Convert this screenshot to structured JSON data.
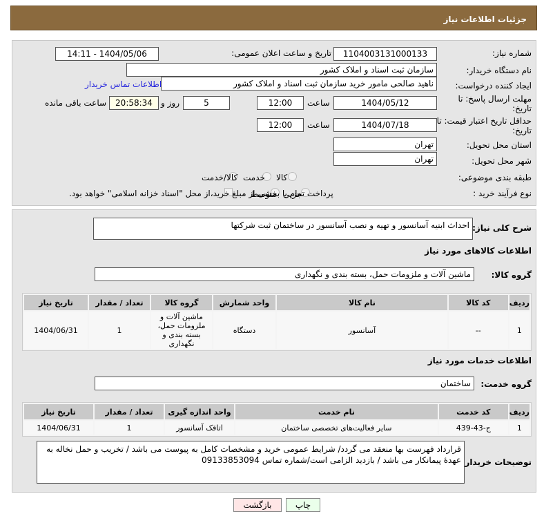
{
  "header": {
    "title": "جزئیات اطلاعات نیاز"
  },
  "form": {
    "need_number_label": "شماره نیاز:",
    "need_number": "1104003131000133",
    "announce_label": "تاریخ و ساعت اعلان عمومی:",
    "announce_value": "1404/05/06 - 14:11",
    "buyer_org_label": "نام دستگاه خریدار:",
    "buyer_org": "سازمان ثبت اسناد و املاک کشور",
    "creator_label": "ایجاد کننده درخواست:",
    "creator": "ناهید صالحی مامور خرید سازمان ثبت اسناد و املاک کشور",
    "contact_link": "اطلاعات تماس خریدار",
    "deadline_label": "مهلت ارسال پاسخ: تا تاریخ:",
    "deadline_date": "1404/05/12",
    "time_label": "ساعت",
    "deadline_time": "12:00",
    "days": "5",
    "days_label": "روز و",
    "remaining": "20:58:34",
    "remaining_label": "ساعت باقی مانده",
    "validity_label": "حداقل تاریخ اعتبار قیمت: تا تاریخ:",
    "validity_date": "1404/07/18",
    "validity_time": "12:00",
    "province_label": "استان محل تحویل:",
    "province": "تهران",
    "city_label": "شهر محل تحویل:",
    "city": "تهران",
    "category_label": "طبقه بندی موضوعی:",
    "category_options": [
      "کالا",
      "خدمت",
      "کالا/خدمت"
    ],
    "process_label": "نوع فرآیند خرید :",
    "process_options": [
      "جزیی",
      "متوسط"
    ],
    "payment_note": "پرداخت تمام یا بخشی از مبلغ خرید،از محل \"اسناد خزانه اسلامی\" خواهد بود."
  },
  "description": {
    "label": "شرح کلی نیاز:",
    "value": "احداث ابنیه آسانسور و تهیه و نصب آسانسور در ساختمان ثبت شرکتها"
  },
  "goods": {
    "title": "اطلاعات کالاهای مورد نیاز",
    "group_label": "گروه کالا:",
    "group": "ماشین آلات و ملزومات حمل، بسته بندی و نگهداری",
    "headers": [
      "ردیف",
      "کد کالا",
      "نام کالا",
      "واحد شمارش",
      "گروه کالا",
      "تعداد / مقدار",
      "تاریخ نیاز"
    ],
    "rows": [
      [
        "1",
        "--",
        "آسانسور",
        "دستگاه",
        "ماشین آلات و ملزومات حمل، بسته بندی و نگهداری",
        "1",
        "1404/06/31"
      ]
    ]
  },
  "services": {
    "title": "اطلاعات خدمات مورد نیاز",
    "group_label": "گروه خدمت:",
    "group": "ساختمان",
    "headers": [
      "ردیف",
      "کد خدمت",
      "نام خدمت",
      "واحد اندازه گیری",
      "تعداد / مقدار",
      "تاریخ نیاز"
    ],
    "rows": [
      [
        "1",
        "ج-43-439",
        "سایر فعالیت‌های تخصصی ساختمان",
        "اتاقک آسانسور",
        "1",
        "1404/06/31"
      ]
    ]
  },
  "notes": {
    "label": "توضیحات خریدار:",
    "value": "قرارداد فهرست بها منعقد می گردد/ شرایط عمومی خرید و مشخصات کامل به پیوست می باشد / تخریب و حمل نخاله به عهدهٔ پیمانکار می باشد / بازدید الزامی است/شماره تماس 09133853094"
  },
  "buttons": {
    "print": "چاپ",
    "back": "بازگشت"
  }
}
